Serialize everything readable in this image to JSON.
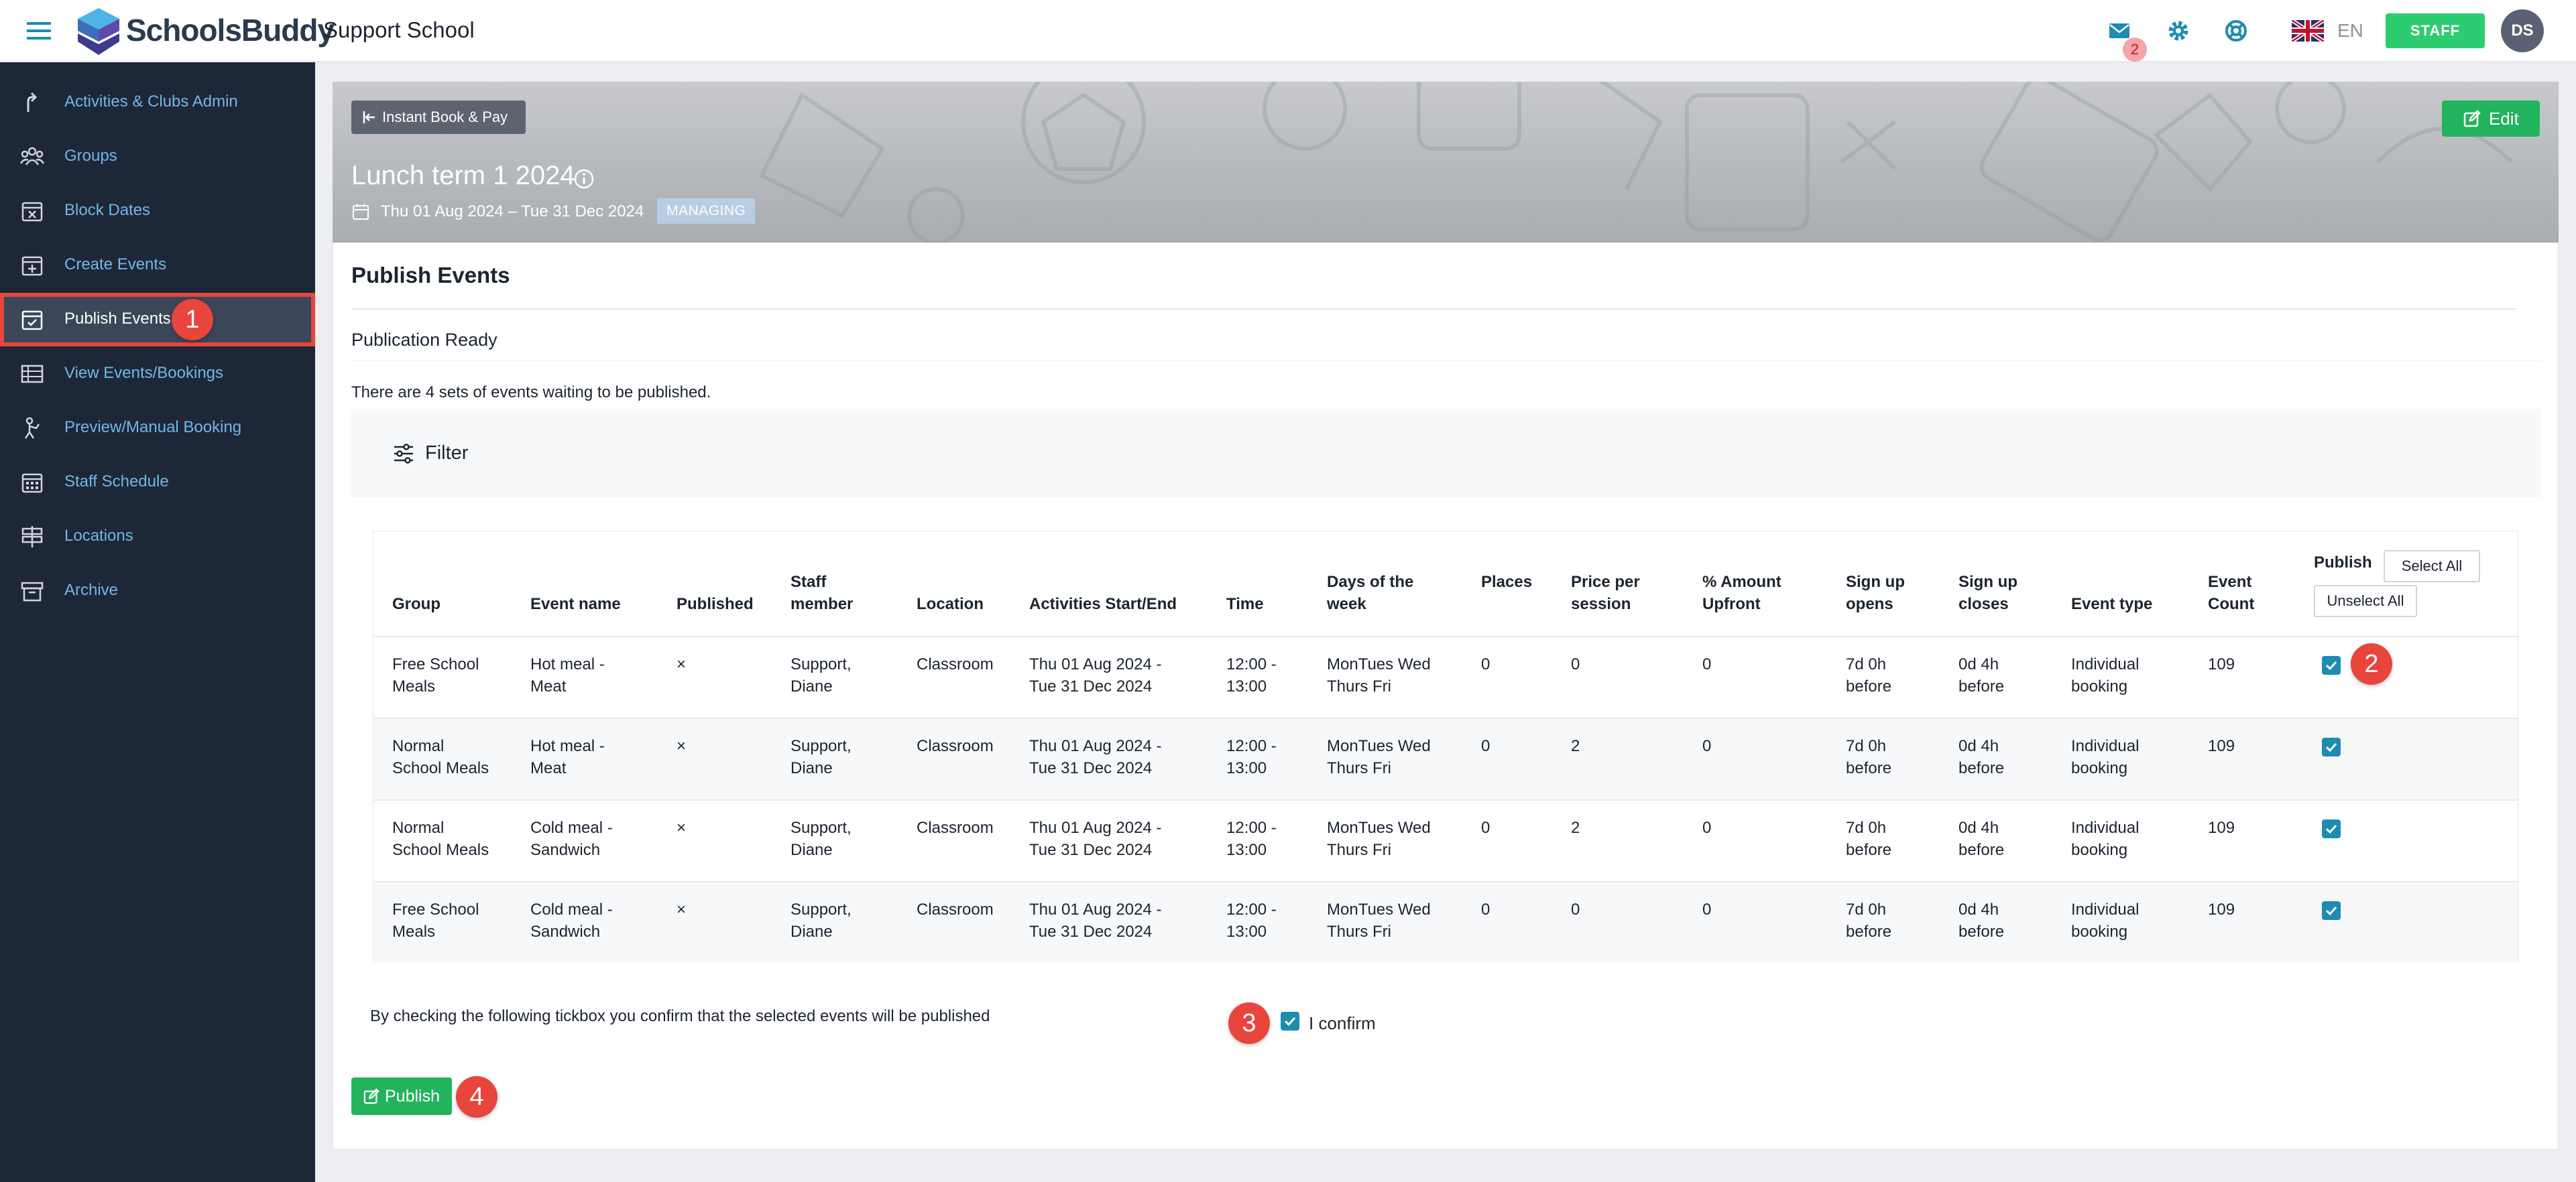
{
  "app": {
    "brand": "SchoolsBuddy",
    "school": "Support School",
    "mail_count": "2",
    "language": "EN",
    "role_button": "STAFF",
    "avatar_initials": "DS",
    "icons": [
      "menu-icon",
      "mail-icon",
      "gear-icon",
      "help-icon",
      "uk-flag-icon"
    ]
  },
  "sidebar": {
    "items": [
      {
        "label": "Activities & Clubs Admin",
        "icon": "arrow-up-icon"
      },
      {
        "label": "Groups",
        "icon": "users-icon"
      },
      {
        "label": "Block Dates",
        "icon": "calendar-x-icon"
      },
      {
        "label": "Create Events",
        "icon": "calendar-plus-icon"
      },
      {
        "label": "Publish Events",
        "icon": "calendar-check-icon",
        "active": true
      },
      {
        "label": "View Events/Bookings",
        "icon": "table-icon"
      },
      {
        "label": "Preview/Manual Booking",
        "icon": "person-icon"
      },
      {
        "label": "Staff Schedule",
        "icon": "calendar-grid-icon"
      },
      {
        "label": "Locations",
        "icon": "signpost-icon"
      },
      {
        "label": "Archive",
        "icon": "archive-icon"
      }
    ]
  },
  "banner": {
    "back_label": "Instant Book & Pay",
    "edit_label": "Edit",
    "title": "Lunch term 1 2024",
    "dates": "Thu 01 Aug 2024 – Tue 31 Dec 2024",
    "badge": "MANAGING"
  },
  "content": {
    "heading": "Publish Events",
    "subheading": "Publication Ready",
    "waiting_text": "There are 4 sets of events waiting to be published.",
    "filter_label": "Filter"
  },
  "table": {
    "headers": {
      "group": "Group",
      "event_name": "Event name",
      "published": "Published",
      "staff_l1": "Staff",
      "staff_l2": "member",
      "location": "Location",
      "activities": "Activities Start/End",
      "time": "Time",
      "days_l1": "Days of the",
      "days_l2": "week",
      "places": "Places",
      "price_l1": "Price per",
      "price_l2": "session",
      "amount_l1": "% Amount",
      "amount_l2": "Upfront",
      "opens_l1": "Sign up",
      "opens_l2": "opens",
      "closes_l1": "Sign up",
      "closes_l2": "closes",
      "type": "Event type",
      "count_l1": "Event",
      "count_l2": "Count",
      "publish": "Publish",
      "select_all": "Select All",
      "unselect_all": "Unselect All"
    },
    "rows": [
      {
        "group_l1": "Free School",
        "group_l2": "Meals",
        "event_l1": "Hot meal -",
        "event_l2": "Meat",
        "published": "×",
        "staff_l1": "Support,",
        "staff_l2": "Diane",
        "location": "Classroom",
        "act_l1": "Thu 01 Aug 2024 -",
        "act_l2": "Tue 31 Dec 2024",
        "time_l1": "12:00 -",
        "time_l2": "13:00",
        "days_l1": "MonTues Wed",
        "days_l2": "Thurs Fri",
        "places": "0",
        "price": "0",
        "upfront": "0",
        "opens_l1": "7d 0h",
        "opens_l2": "before",
        "closes_l1": "0d 4h",
        "closes_l2": "before",
        "type_l1": "Individual",
        "type_l2": "booking",
        "count": "109",
        "checked": true
      },
      {
        "group_l1": "Normal",
        "group_l2": "School Meals",
        "event_l1": "Hot meal -",
        "event_l2": "Meat",
        "published": "×",
        "staff_l1": "Support,",
        "staff_l2": "Diane",
        "location": "Classroom",
        "act_l1": "Thu 01 Aug 2024 -",
        "act_l2": "Tue 31 Dec 2024",
        "time_l1": "12:00 -",
        "time_l2": "13:00",
        "days_l1": "MonTues Wed",
        "days_l2": "Thurs Fri",
        "places": "0",
        "price": "2",
        "upfront": "0",
        "opens_l1": "7d 0h",
        "opens_l2": "before",
        "closes_l1": "0d 4h",
        "closes_l2": "before",
        "type_l1": "Individual",
        "type_l2": "booking",
        "count": "109",
        "checked": true
      },
      {
        "group_l1": "Normal",
        "group_l2": "School Meals",
        "event_l1": "Cold meal -",
        "event_l2": "Sandwich",
        "published": "×",
        "staff_l1": "Support,",
        "staff_l2": "Diane",
        "location": "Classroom",
        "act_l1": "Thu 01 Aug 2024 -",
        "act_l2": "Tue 31 Dec 2024",
        "time_l1": "12:00 -",
        "time_l2": "13:00",
        "days_l1": "MonTues Wed",
        "days_l2": "Thurs Fri",
        "places": "0",
        "price": "2",
        "upfront": "0",
        "opens_l1": "7d 0h",
        "opens_l2": "before",
        "closes_l1": "0d 4h",
        "closes_l2": "before",
        "type_l1": "Individual",
        "type_l2": "booking",
        "count": "109",
        "checked": true
      },
      {
        "group_l1": "Free School",
        "group_l2": "Meals",
        "event_l1": "Cold meal -",
        "event_l2": "Sandwich",
        "published": "×",
        "staff_l1": "Support,",
        "staff_l2": "Diane",
        "location": "Classroom",
        "act_l1": "Thu 01 Aug 2024 -",
        "act_l2": "Tue 31 Dec 2024",
        "time_l1": "12:00 -",
        "time_l2": "13:00",
        "days_l1": "MonTues Wed",
        "days_l2": "Thurs Fri",
        "places": "0",
        "price": "0",
        "upfront": "0",
        "opens_l1": "7d 0h",
        "opens_l2": "before",
        "closes_l1": "0d 4h",
        "closes_l2": "before",
        "type_l1": "Individual",
        "type_l2": "booking",
        "count": "109",
        "checked": true
      }
    ]
  },
  "confirm": {
    "text": "By checking the following tickbox you confirm that the selected events will be published",
    "label": "I confirm",
    "checked": true
  },
  "publish_label": "Publish",
  "steps": [
    "1",
    "2",
    "3",
    "4"
  ],
  "colors": {
    "sidebar_bg": "#1e2738",
    "sidebar_link": "#6fb8e6",
    "accent_green": "#22b45c",
    "checkbox_blue": "#1d8cb0",
    "step_red": "#e8453c"
  }
}
